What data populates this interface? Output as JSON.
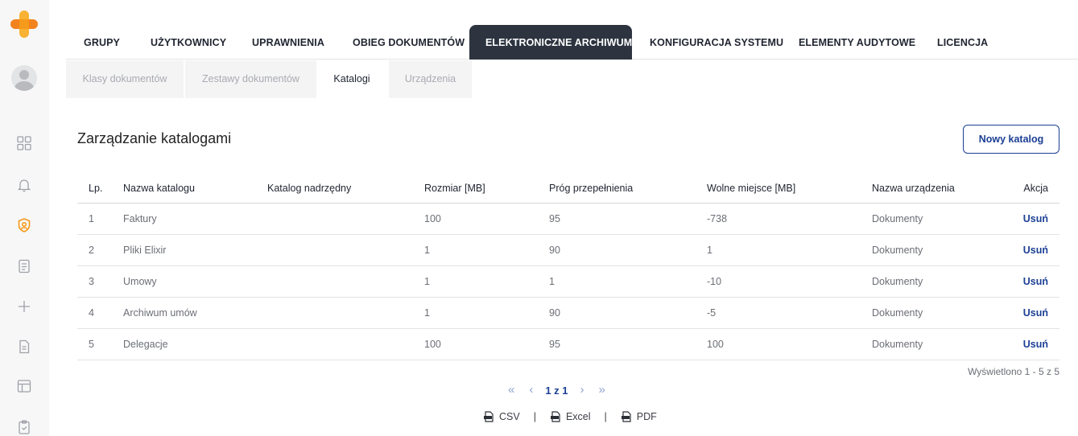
{
  "sidebar": {
    "icons": [
      "app-logo-icon",
      "user-avatar",
      "dashboard-grid-icon",
      "bell-icon",
      "shield-user-icon",
      "checklist-icon",
      "plus-icon",
      "document-icon",
      "layout-icon",
      "clipboard-check-icon"
    ],
    "accent_color": "#f59a1b"
  },
  "top_tabs": [
    {
      "label": "GRUPY"
    },
    {
      "label": "UŻYTKOWNICY"
    },
    {
      "label": "UPRAWNIENIA"
    },
    {
      "label": "OBIEG DOKUMENTÓW"
    },
    {
      "label": "ELEKTRONICZNE ARCHIWUM",
      "active": true
    },
    {
      "label": "KONFIGURACJA SYSTEMU"
    },
    {
      "label": "ELEMENTY AUDYTOWE"
    },
    {
      "label": "LICENCJA"
    }
  ],
  "sub_tabs": [
    {
      "label": "Klasy dokumentów"
    },
    {
      "label": "Zestawy dokumentów"
    },
    {
      "label": "Katalogi",
      "active": true
    },
    {
      "label": "Urządzenia"
    }
  ],
  "page_title": "Zarządzanie katalogami",
  "new_button_label": "Nowy katalog",
  "table": {
    "columns": [
      "Lp.",
      "Nazwa katalogu",
      "Katalog nadrzędny",
      "Rozmiar [MB]",
      "Próg przepełnienia",
      "Wolne miejsce [MB]",
      "Nazwa urządzenia",
      "Akcja"
    ],
    "rows": [
      [
        "1",
        "Faktury",
        "",
        "100",
        "95",
        "-738",
        "Dokumenty",
        "Usuń"
      ],
      [
        "2",
        "Pliki Elixir",
        "",
        "1",
        "90",
        "1",
        "Dokumenty",
        "Usuń"
      ],
      [
        "3",
        "Umowy",
        "",
        "1",
        "1",
        "-10",
        "Dokumenty",
        "Usuń"
      ],
      [
        "4",
        "Archiwum umów",
        "",
        "1",
        "90",
        "-5",
        "Dokumenty",
        "Usuń"
      ],
      [
        "5",
        "Delegacje",
        "",
        "100",
        "95",
        "100",
        "Dokumenty",
        "Usuń"
      ]
    ]
  },
  "shown_text": "Wyświetlono 1 - 5 z 5",
  "pagination": {
    "first": "«",
    "prev": "‹",
    "info": "1 z 1",
    "next": "›",
    "last": "»"
  },
  "export": {
    "csv": "CSV",
    "excel": "Excel",
    "pdf": "PDF",
    "separator": "|"
  },
  "colors": {
    "primary": "#1b3f94",
    "dark_tab": "#2d3440",
    "link": "#1b3f94"
  }
}
